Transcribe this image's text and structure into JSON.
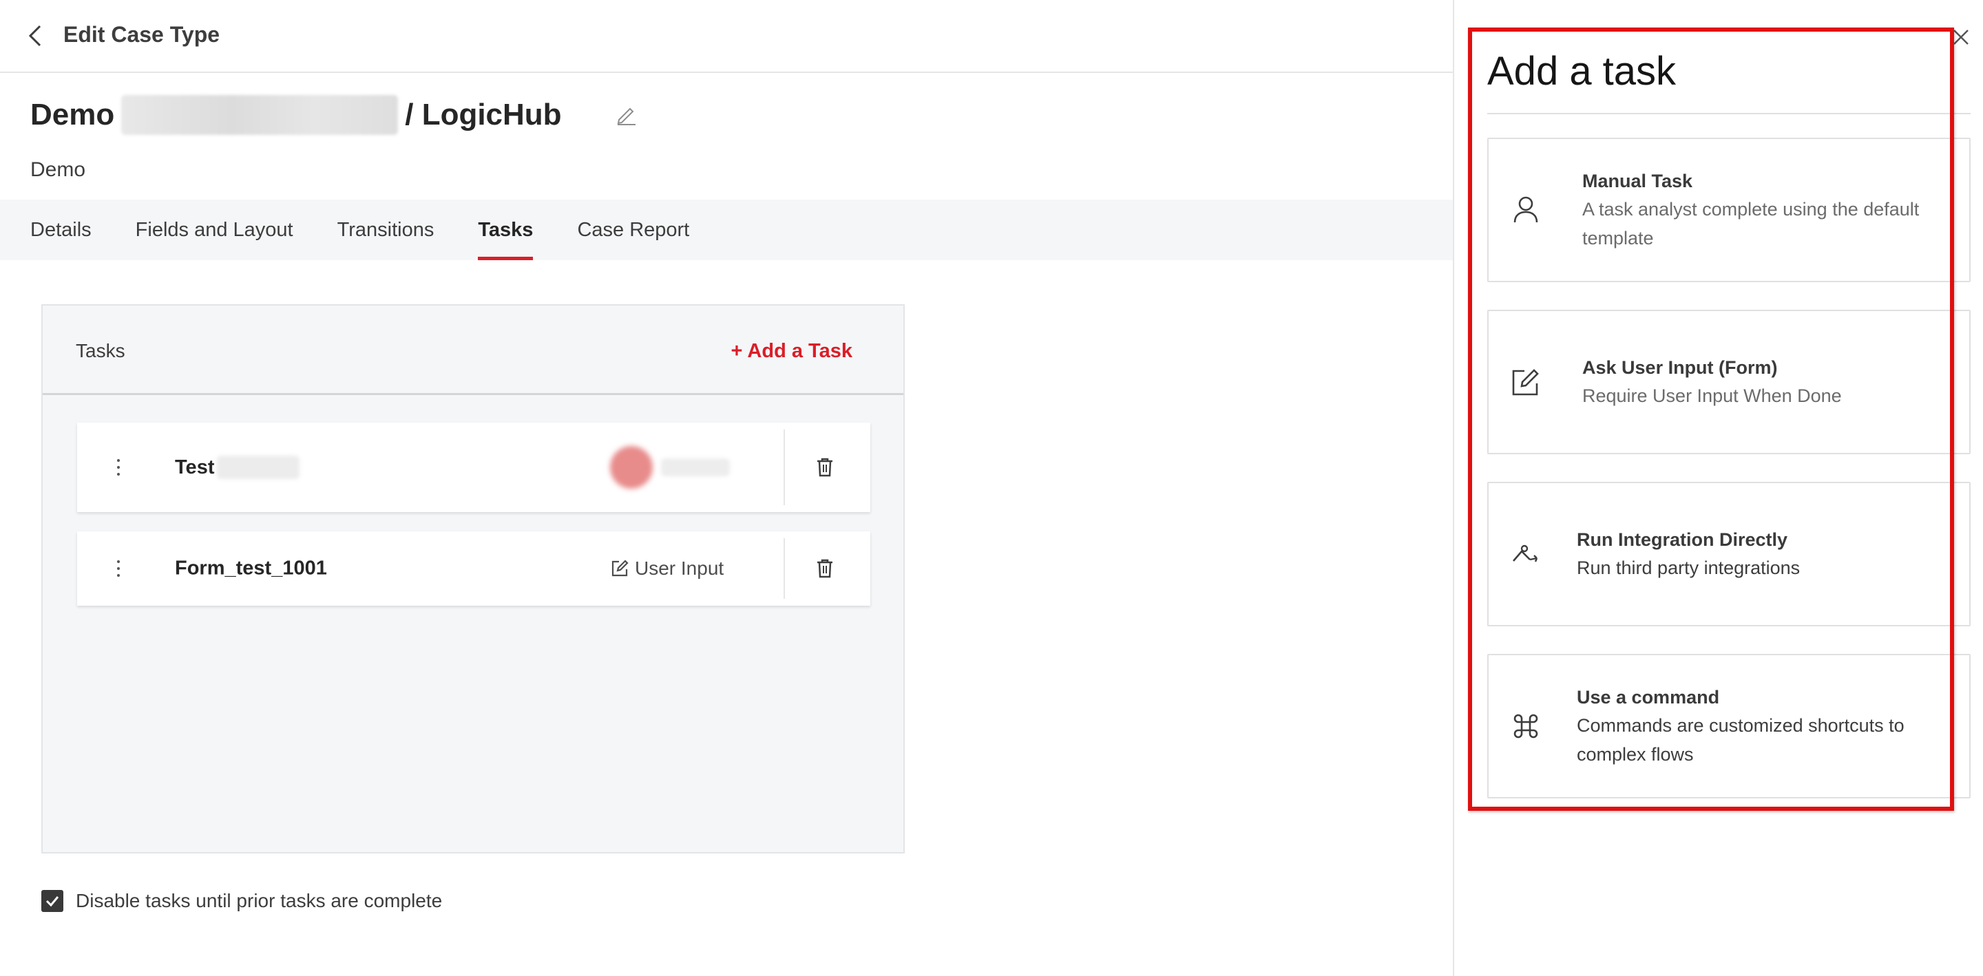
{
  "topbar": {
    "title": "Edit Case Type",
    "back_icon": "chevron-left-icon"
  },
  "case": {
    "title_prefix": "Demo",
    "title_suffix": "/ LogicHub",
    "subtitle": "Demo",
    "edit_icon": "pencil-icon"
  },
  "tabs": [
    {
      "label": "Details",
      "active": false
    },
    {
      "label": "Fields and Layout",
      "active": false
    },
    {
      "label": "Transitions",
      "active": false
    },
    {
      "label": "Tasks",
      "active": true
    },
    {
      "label": "Case Report",
      "active": false
    }
  ],
  "tasks_panel": {
    "title": "Tasks",
    "add_link": "+ Add a Task",
    "rows": [
      {
        "name": "Test",
        "type": ""
      },
      {
        "name": "Form_test_1001",
        "type": "User Input"
      }
    ]
  },
  "options": {
    "disable_tasks_label": "Disable tasks until prior tasks are complete",
    "disable_tasks_checked": true
  },
  "drawer": {
    "title": "Add a task",
    "close_icon": "close-icon",
    "highlight_color": "#e01010",
    "cards": [
      {
        "title": "Manual Task",
        "description": "A task analyst complete using the default template",
        "icon": "user-icon"
      },
      {
        "title": "Ask User Input (Form)",
        "description": "Require User Input When Done",
        "icon": "edit-form-icon"
      },
      {
        "title": "Run Integration Directly",
        "description": "Run third party integrations",
        "icon": "integration-icon"
      },
      {
        "title": "Use a command",
        "description": "Commands are customized shortcuts to complex flows",
        "icon": "command-icon"
      }
    ]
  },
  "colors": {
    "accent": "#da1e28",
    "tab_bar_bg": "#f5f6f8"
  }
}
